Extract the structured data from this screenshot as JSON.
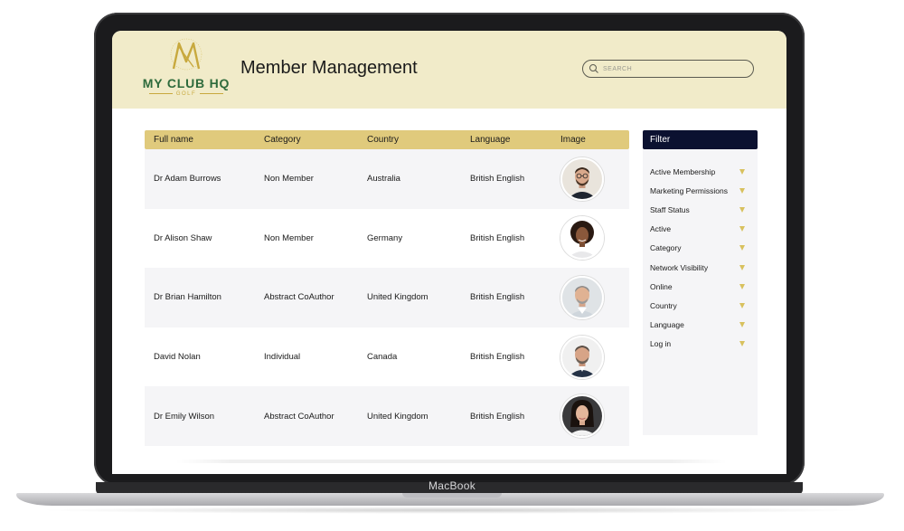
{
  "device": {
    "brand": "MacBook"
  },
  "app": {
    "logo_text": "MY CLUB HQ",
    "logo_subtext": "GOLF",
    "title": "Member Management",
    "search_placeholder": "SEARCH",
    "brand_color": "#2e6b3c",
    "accent_color": "#e0ca7c",
    "header_bg": "#f1ebc9"
  },
  "table": {
    "columns": [
      "Full name",
      "Category",
      "Country",
      "Language",
      "Image"
    ],
    "rows": [
      {
        "name": "Dr Adam Burrows",
        "category": "Non Member",
        "country": "Australia",
        "language": "British English",
        "avatar": "man-glasses-beard"
      },
      {
        "name": "Dr Alison Shaw",
        "category": "Non Member",
        "country": "Germany",
        "language": "British English",
        "avatar": "woman-curly-hair"
      },
      {
        "name": "Dr Brian Hamilton",
        "category": "Abstract CoAuthor",
        "country": "United Kingdom",
        "language": "British English",
        "avatar": "man-grey-hair"
      },
      {
        "name": "David Nolan",
        "category": "Individual",
        "country": "Canada",
        "language": "British English",
        "avatar": "man-suit-beard"
      },
      {
        "name": "Dr Emily Wilson",
        "category": "Abstract CoAuthor",
        "country": "United Kingdom",
        "language": "British English",
        "avatar": "woman-dark-hair"
      }
    ]
  },
  "filter": {
    "title": "Filter",
    "header_color": "#0b1130",
    "items": [
      "Active Membership",
      "Marketing Permissions",
      "Staff Status",
      "Active",
      "Category",
      "Network Visibility",
      "Online",
      "Country",
      "Language",
      "Log in"
    ]
  }
}
